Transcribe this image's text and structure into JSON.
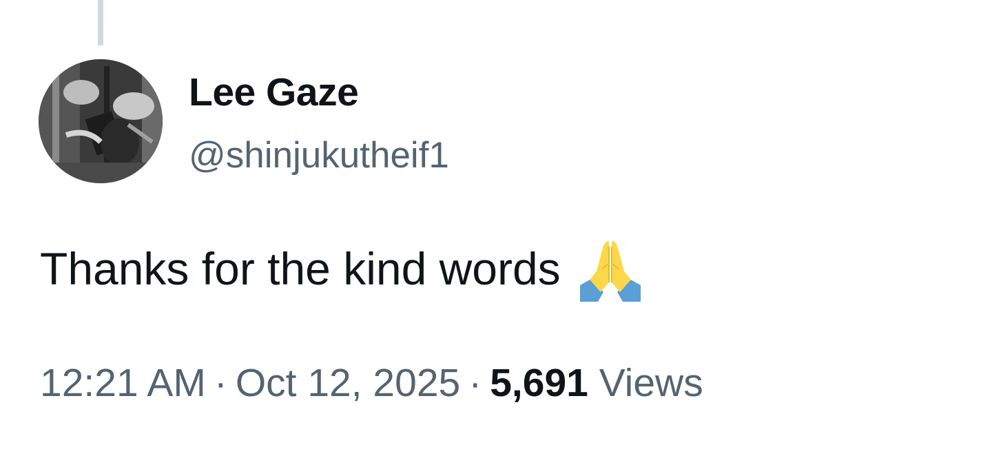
{
  "tweet": {
    "author": {
      "name": "Lee Gaze",
      "handle": "@shinjukutheif1"
    },
    "text": "Thanks for the kind words",
    "emoji": "🙏",
    "meta": {
      "time": "12:21 AM",
      "separator": "·",
      "date": "Oct 12, 2025",
      "views_count": "5,691",
      "views_label": "Views"
    }
  },
  "colors": {
    "primary_text": "#0f1419",
    "secondary_text": "#536471",
    "thread_line": "#cfd9de"
  },
  "icons": {
    "emoji": "folded-hands-icon"
  }
}
